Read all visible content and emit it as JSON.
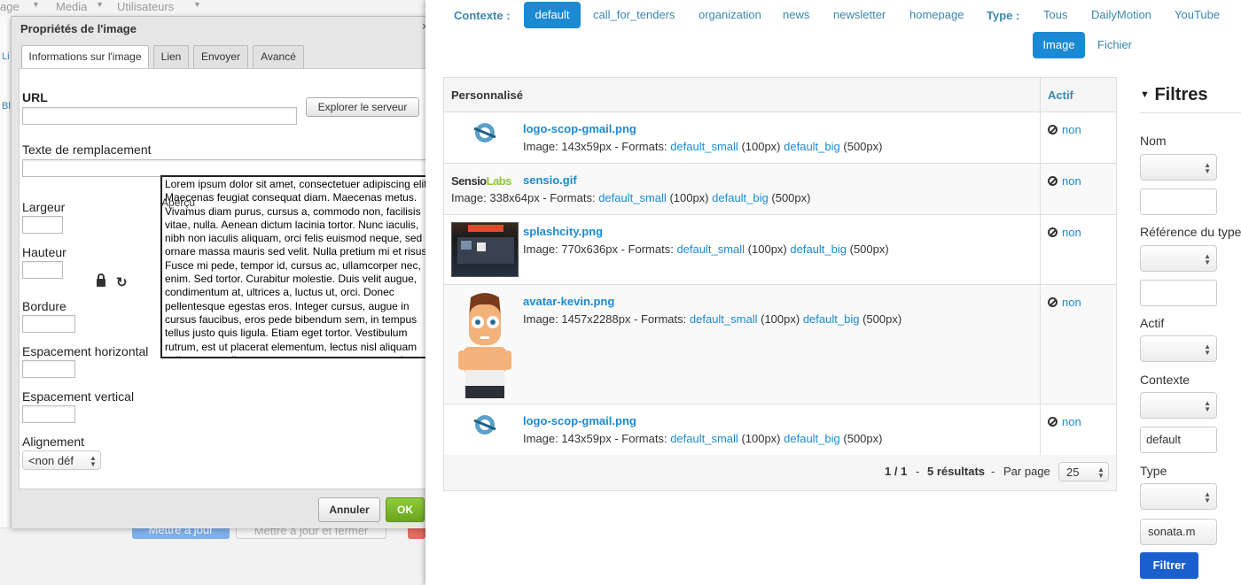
{
  "background": {
    "menu_items": [
      "age",
      "Media",
      "Utilisateurs"
    ],
    "side_link_1": "Li",
    "side_link_2": "Bl",
    "btn_update": "Mettre à jour",
    "btn_update_close": "Mettre à jour et fermer"
  },
  "dialog": {
    "title": "Propriétés de l'image",
    "close": "×",
    "tabs": [
      "Informations sur l'image",
      "Lien",
      "Envoyer",
      "Avancé"
    ],
    "url_label": "URL",
    "browse_button": "Explorer le serveur",
    "alt_label": "Texte de remplacement",
    "width_label": "Largeur",
    "height_label": "Hauteur",
    "border_label": "Bordure",
    "hspace_label": "Espacement horizontal",
    "vspace_label": "Espacement vertical",
    "align_label": "Alignement",
    "align_value": "<non déf",
    "preview_label": "Aperçu",
    "preview_text": "Lorem ipsum dolor sit amet, consectetuer adipiscing elit. Maecenas feugiat consequat diam. Maecenas metus. Vivamus diam purus, cursus a, commodo non, facilisis vitae, nulla. Aenean dictum lacinia tortor. Nunc iaculis, nibh non iaculis aliquam, orci felis euismod neque, sed ornare massa mauris sed velit. Nulla pretium mi et risus. Fusce mi pede, tempor id, cursus ac, ullamcorper nec, enim. Sed tortor. Curabitur molestie. Duis velit augue, condimentum at, ultrices a, luctus ut, orci. Donec pellentesque egestas eros. Integer cursus, augue in cursus faucibus, eros pede bibendum sem, in tempus tellus justo quis ligula. Etiam eget tortor. Vestibulum rutrum, est ut placerat elementum, lectus nisl aliquam velit, tempor aliquam eros nunc nonummy metus. In eros metus, gravida a",
    "cancel_button": "Annuler",
    "ok_button": "OK"
  },
  "browser": {
    "context_label": "Contexte :",
    "contexts": [
      "default",
      "call_for_tenders",
      "organization",
      "news",
      "newsletter",
      "homepage"
    ],
    "type_label": "Type :",
    "types": [
      "Tous",
      "DailyMotion",
      "YouTube",
      "Image",
      "Fichier"
    ],
    "table": {
      "col_custom": "Personnalisé",
      "col_active": "Actif",
      "rows": [
        {
          "name": "logo-scop-gmail.png",
          "size": "Image: 143x59px - Formats:",
          "fmt1": "default_small",
          "fmt1_px": "(100px)",
          "fmt2": "default_big",
          "fmt2_px": "(500px)",
          "active": "non",
          "thumb": "scop-logo"
        },
        {
          "name": "sensio.gif",
          "size": "Image: 338x64px - Formats:",
          "fmt1": "default_small",
          "fmt1_px": "(100px)",
          "fmt2": "default_big",
          "fmt2_px": "(500px)",
          "active": "non",
          "thumb": "sensiolabs-logo",
          "thumb_text_1": "Sensio",
          "thumb_text_2": "Labs"
        },
        {
          "name": "splashcity.png",
          "size": "Image: 770x636px - Formats:",
          "fmt1": "default_small",
          "fmt1_px": "(100px)",
          "fmt2": "default_big",
          "fmt2_px": "(500px)",
          "active": "non",
          "thumb": "splashcity-screenshot"
        },
        {
          "name": "avatar-kevin.png",
          "size": "Image: 1457x2288px - Formats:",
          "fmt1": "default_small",
          "fmt1_px": "(100px)",
          "fmt2": "default_big",
          "fmt2_px": "(500px)",
          "active": "non",
          "thumb": "avatar-character"
        },
        {
          "name": "logo-scop-gmail.png",
          "size": "Image: 143x59px - Formats:",
          "fmt1": "default_small",
          "fmt1_px": "(100px)",
          "fmt2": "default_big",
          "fmt2_px": "(500px)",
          "active": "non",
          "thumb": "scop-logo"
        }
      ]
    },
    "pager": {
      "pages": "1 / 1",
      "sep": "-",
      "results": "5 résultats",
      "per_page_label": "Par page",
      "per_page_value": "25"
    }
  },
  "filters": {
    "title": "Filtres",
    "name_label": "Nom",
    "type_ref_label": "Référence du type",
    "active_label": "Actif",
    "context_label": "Contexte",
    "context_value": "default",
    "type_label": "Type",
    "type_value": "sonata.m",
    "submit": "Filtrer"
  },
  "colors": {
    "accent": "#1b8ad2",
    "ok": "#78b82a",
    "filter_button": "#1b5fcf"
  }
}
